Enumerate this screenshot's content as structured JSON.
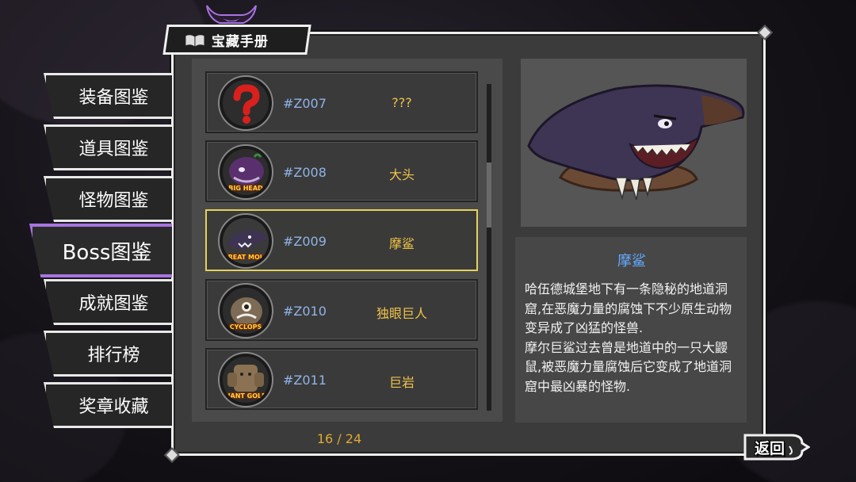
{
  "title": "宝藏手册",
  "nav": {
    "items": [
      {
        "label": "装备图鉴"
      },
      {
        "label": "道具图鉴"
      },
      {
        "label": "怪物图鉴"
      },
      {
        "label": "Boss图鉴"
      },
      {
        "label": "成就图鉴"
      },
      {
        "label": "排行榜"
      },
      {
        "label": "奖章收藏"
      }
    ],
    "active_index": 3
  },
  "list": {
    "rows": [
      {
        "id": "#Z007",
        "name": "???",
        "portrait_icon": "question-mark-icon",
        "portrait_label": ""
      },
      {
        "id": "#Z008",
        "name": "大头",
        "portrait_icon": "big-head-boss-portrait",
        "portrait_label": "BIG HEAD"
      },
      {
        "id": "#Z009",
        "name": "摩鲨",
        "portrait_icon": "great-moleshark-boss-portrait",
        "portrait_label": "GREAT MOLESHARK"
      },
      {
        "id": "#Z010",
        "name": "独眼巨人",
        "portrait_icon": "cyclops-boss-portrait",
        "portrait_label": "CYCLOPS"
      },
      {
        "id": "#Z011",
        "name": "巨岩",
        "portrait_icon": "giant-golem-boss-portrait",
        "portrait_label": "GIANT GOLEM"
      }
    ],
    "selected_index": 2
  },
  "page": {
    "text": "16 / 24"
  },
  "detail": {
    "title": "摩鲨",
    "text1": "哈伍德城堡地下有一条隐秘的地道洞窟,在恶魔力量的腐蚀下不少原生动物变异成了凶猛的怪兽.",
    "text2": "摩尔巨鲨过去曾是地道中的一只大鼹鼠,被恶魔力量腐蚀后它变成了地道洞窟中最凶暴的怪物."
  },
  "back": {
    "label": "返回"
  },
  "colors": {
    "accent_purple": "#a774e0",
    "selected_yellow": "#e4d25a",
    "id_blue": "#8fb4e8",
    "name_gold": "#f0c34a",
    "title_blue": "#63a9ff"
  }
}
